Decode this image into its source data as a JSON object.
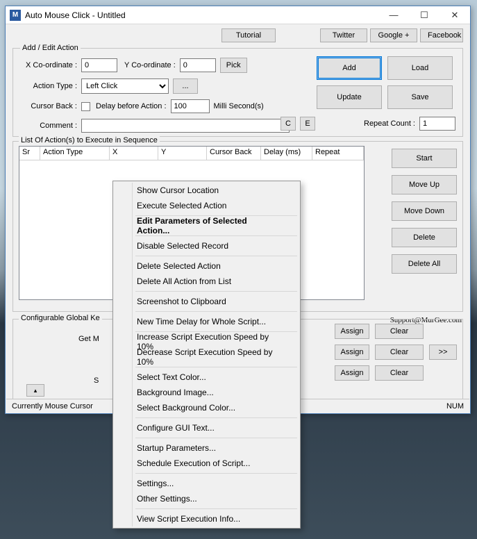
{
  "title": "Auto Mouse Click - Untitled",
  "app_icon_letter": "M",
  "links": {
    "tutorial": "Tutorial",
    "twitter": "Twitter",
    "google": "Google +",
    "facebook": "Facebook"
  },
  "fieldset1_legend": "Add / Edit Action",
  "xcoord_label": "X Co-ordinate :",
  "xcoord_value": "0",
  "ycoord_label": "Y Co-ordinate :",
  "ycoord_value": "0",
  "pick": "Pick",
  "action_type_label": "Action Type :",
  "action_type_value": "Left Click",
  "ellipsis": "...",
  "cursor_back_label": "Cursor Back :",
  "delay_label": "Delay before Action :",
  "delay_value": "100",
  "delay_units": "Milli Second(s)",
  "comment_label": "Comment :",
  "comment_value": "",
  "btn_c": "C",
  "btn_e": "E",
  "repeat_label": "Repeat Count :",
  "repeat_value": "1",
  "btns": {
    "add": "Add",
    "load": "Load",
    "update": "Update",
    "save": "Save"
  },
  "list_legend": "List Of Action(s) to Execute in Sequence",
  "cols": {
    "sr": "Sr",
    "atype": "Action Type",
    "x": "X",
    "y": "Y",
    "cb": "Cursor Back",
    "delay": "Delay (ms)",
    "repeat": "Repeat"
  },
  "list_btns": {
    "start": "Start",
    "moveup": "Move Up",
    "movedown": "Move Down",
    "delete": "Delete",
    "deleteall": "Delete All"
  },
  "support": "Support@MurGee.com",
  "gk_legend": "Configurable Global Ke",
  "gk_text": "Get M",
  "gk_text2": "S",
  "assign": "Assign",
  "clear": "Clear",
  "dblarrow": ">>",
  "arrow_up": "▴",
  "status_left": "Currently Mouse Cursor",
  "status_right": "NUM",
  "menu": {
    "show_cursor": "Show Cursor Location",
    "exec_sel": "Execute Selected Action",
    "edit_params": "Edit Parameters of Selected Action...",
    "disable": "Disable Selected Record",
    "del_sel": "Delete Selected Action",
    "del_all": "Delete All Action from List",
    "screenshot": "Screenshot to Clipboard",
    "new_delay": "New Time Delay for Whole Script...",
    "inc_speed": "Increase Script Execution Speed by 10%",
    "dec_speed": "Decrease Script Execution Speed by 10%",
    "text_color": "Select Text Color...",
    "bg_image": "Background Image...",
    "bg_color": "Select Background Color...",
    "gui_text": "Configure GUI Text...",
    "startup": "Startup Parameters...",
    "schedule": "Schedule Execution of Script...",
    "settings": "Settings...",
    "other_settings": "Other Settings...",
    "view_info": "View Script Execution Info..."
  }
}
